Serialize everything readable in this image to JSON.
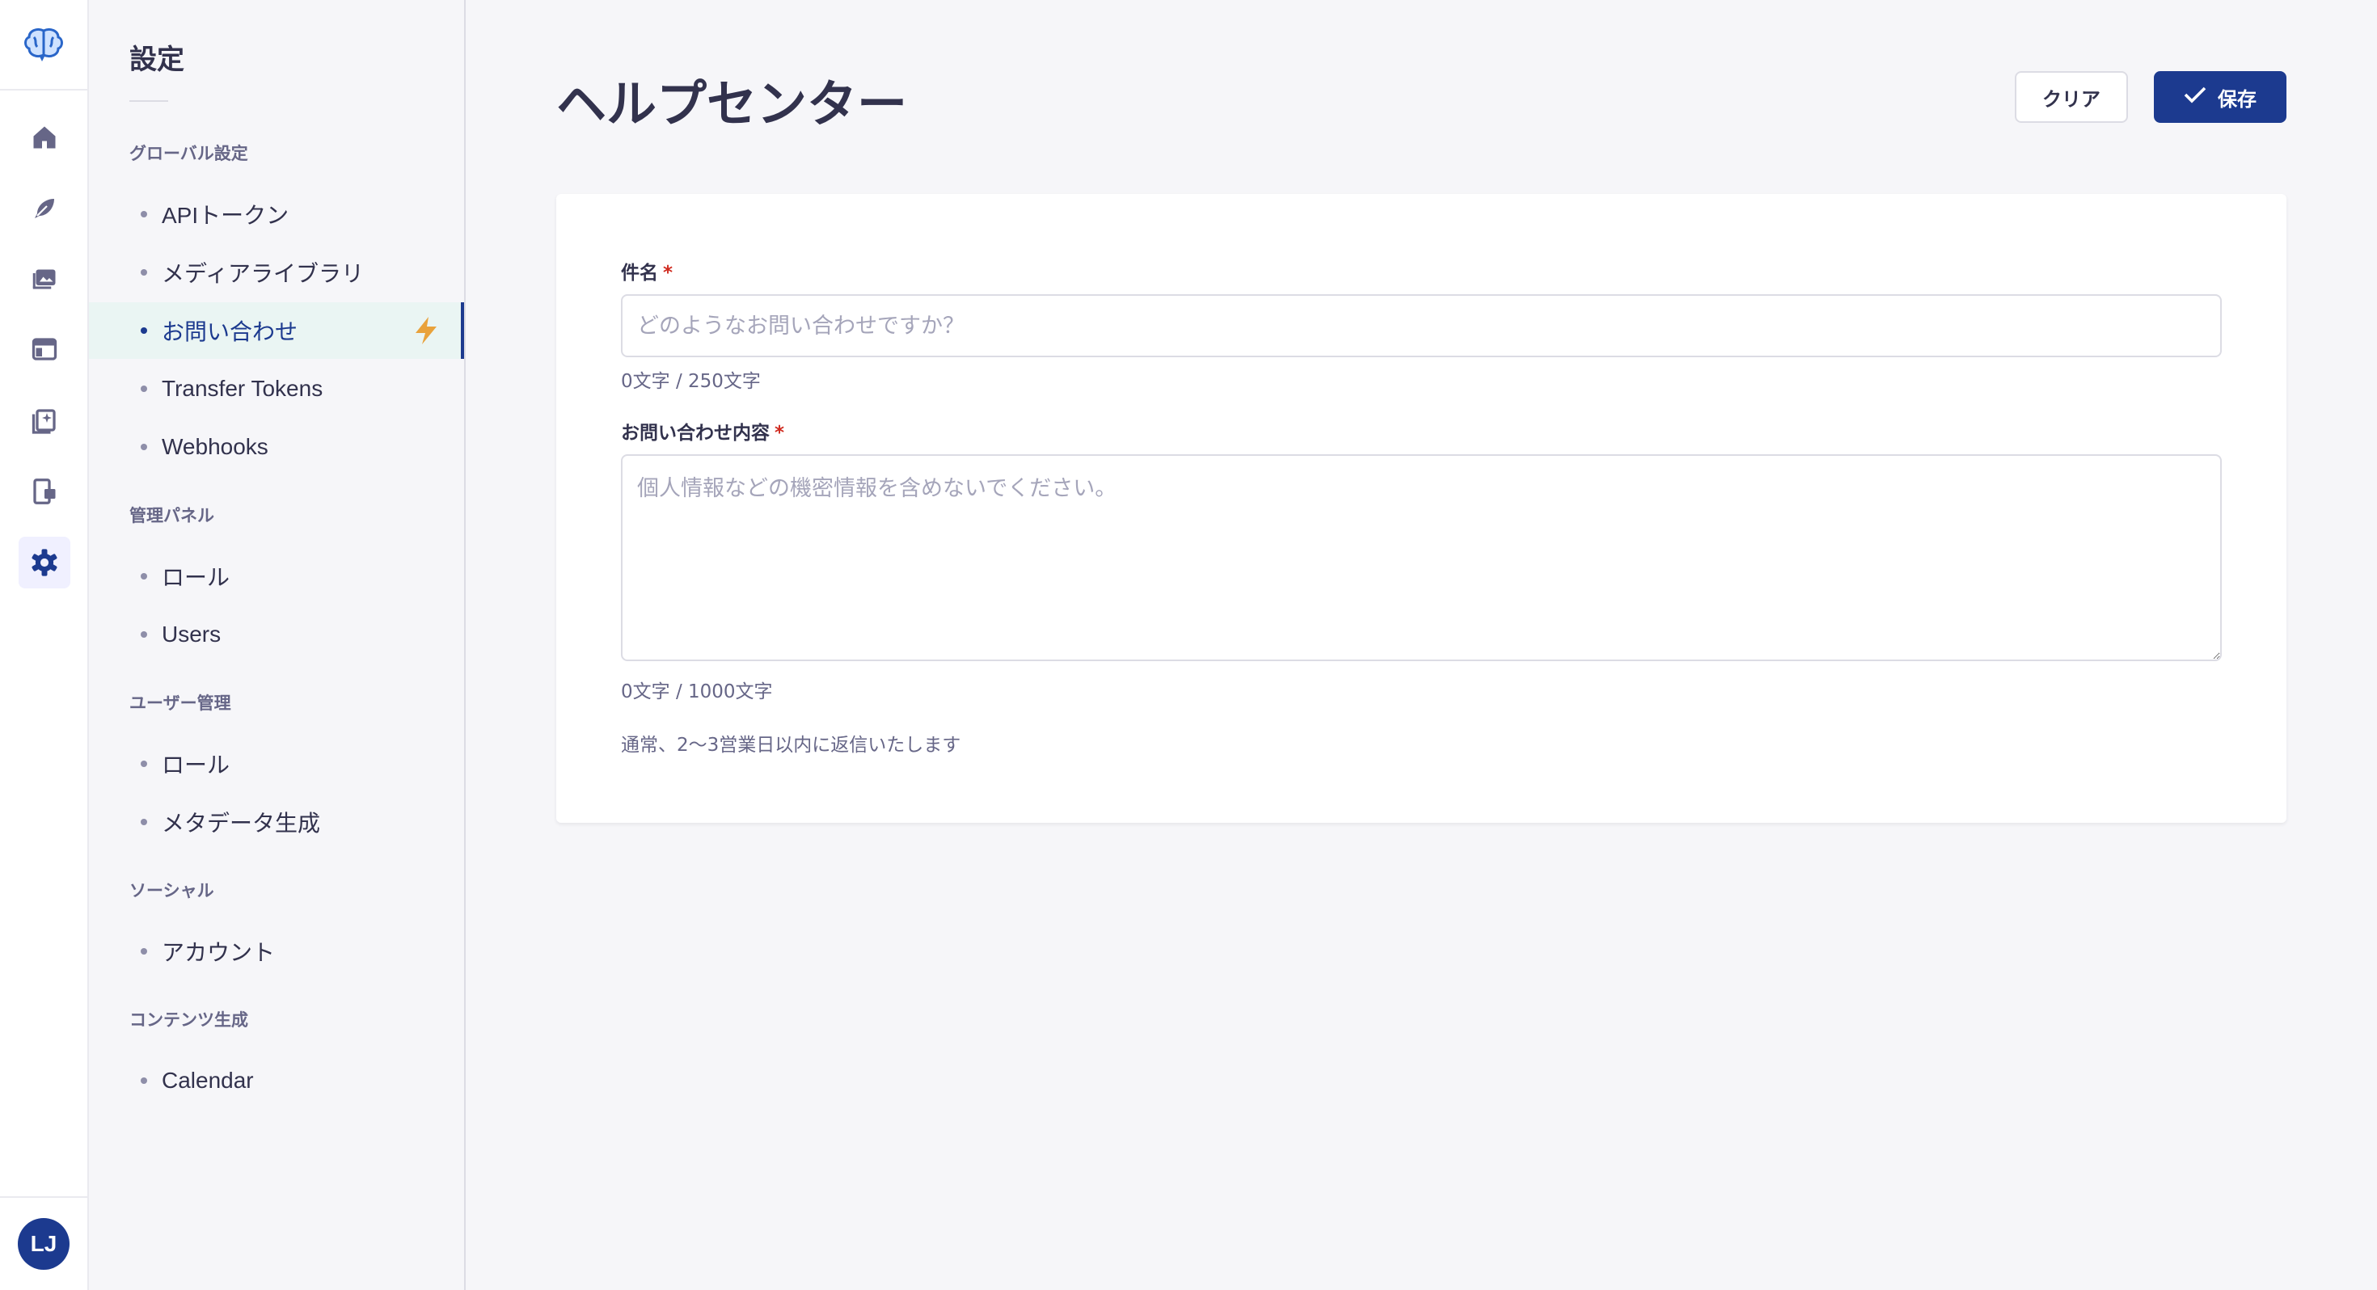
{
  "user": {
    "initials": "LJ"
  },
  "rail": {
    "icons": [
      "brain-logo-icon",
      "home-icon",
      "feather-icon",
      "media-icon",
      "layout-icon",
      "content-ai-icon",
      "devices-icon",
      "gear-icon"
    ],
    "accent": "#1c3a8f"
  },
  "subnav": {
    "title": "設定",
    "groups": [
      {
        "label": "グローバル設定",
        "items": [
          "APIトークン",
          "メディアライブラリ",
          "お問い合わせ",
          "Transfer Tokens",
          "Webhooks"
        ]
      },
      {
        "label": "管理パネル",
        "items": [
          "ロール",
          "Users"
        ]
      },
      {
        "label": "ユーザー管理",
        "items": [
          "ロール",
          "メタデータ生成"
        ]
      },
      {
        "label": "ソーシャル",
        "items": [
          "アカウント"
        ]
      },
      {
        "label": "コンテンツ生成",
        "items": [
          "Calendar"
        ]
      }
    ],
    "active_item": "お問い合わせ",
    "bolt_color": "#e9a23b"
  },
  "main": {
    "title": "ヘルプセンター",
    "clear_label": "クリア",
    "save_label": "保存",
    "subject": {
      "label": "件名",
      "required_mark": "*",
      "placeholder": "どのようなお問い合わせですか？",
      "value": "",
      "counter": "0文字 / 250文字"
    },
    "message": {
      "label": "お問い合わせ内容",
      "required_mark": "*",
      "placeholder": "個人情報などの機密情報を含めないでください。",
      "value": "",
      "counter": "0文字 / 1000文字"
    },
    "hint": "通常、2〜3営業日以内に返信いたします"
  }
}
